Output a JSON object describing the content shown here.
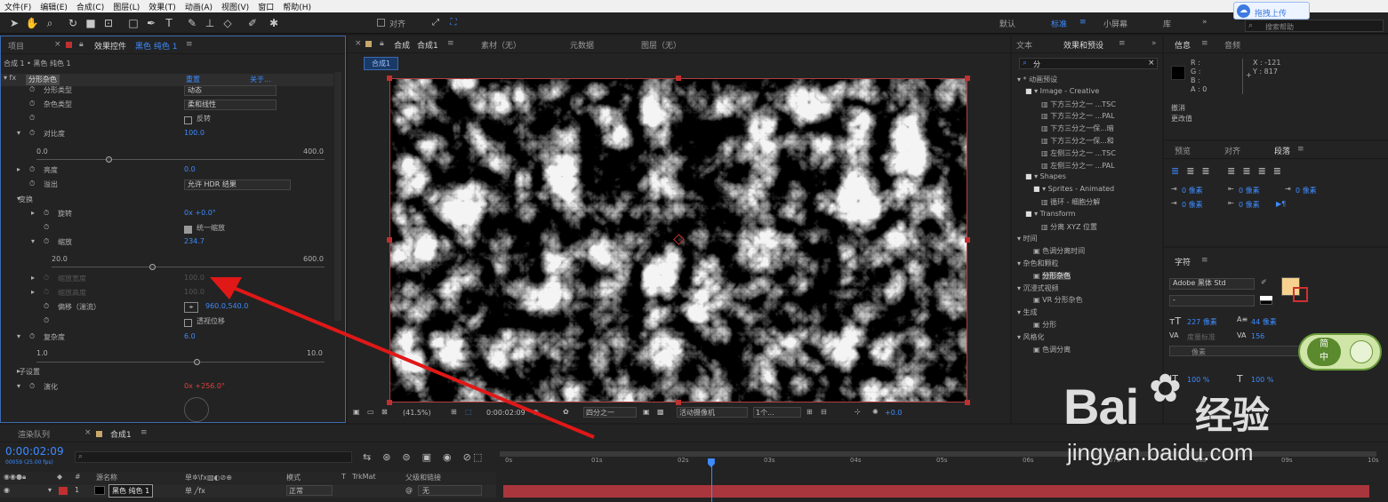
{
  "menu": [
    "文件(F)",
    "编辑(E)",
    "合成(C)",
    "图层(L)",
    "效果(T)",
    "动画(A)",
    "视图(V)",
    "窗口",
    "帮助(H)"
  ],
  "toolbar": {
    "align_label": "对齐",
    "workspaces": [
      "默认",
      "标准",
      "小屏幕",
      "库"
    ],
    "upload_label": "拖拽上传",
    "search_placeholder": "搜索帮助"
  },
  "left_panel": {
    "tab_project": "项目",
    "tab_effects": "效果控件",
    "tab_layer": "黑色 纯色 1",
    "breadcrumb": "合成 1 • 黑色 纯色 1",
    "fx_name": "分形杂色",
    "reset": "重置",
    "about": "关于...",
    "rows": [
      {
        "label": "分形类型",
        "value": "动态",
        "type": "dropdown"
      },
      {
        "label": "杂色类型",
        "value": "柔和线性",
        "type": "dropdown"
      },
      {
        "label": "",
        "value": "反转",
        "type": "checkbox"
      },
      {
        "label": "对比度",
        "value": "100.0",
        "type": "num"
      },
      {
        "label": "亮度",
        "value": "0.0",
        "type": "num"
      },
      {
        "label": "溢出",
        "value": "允许 HDR 结果",
        "type": "dropdown"
      },
      {
        "label": "变换",
        "value": "",
        "type": "group"
      },
      {
        "label": "旋转",
        "value": "0x +0.0°",
        "type": "num"
      },
      {
        "label": "",
        "value": "统一缩放",
        "type": "checkbox"
      },
      {
        "label": "缩放",
        "value": "234.7",
        "type": "num"
      },
      {
        "label": "缩放宽度",
        "value": "100.0",
        "type": "dim"
      },
      {
        "label": "缩放高度",
        "value": "100.0",
        "type": "dim"
      },
      {
        "label": "偏移（湍流）",
        "value": "960.0,540.0",
        "type": "num"
      },
      {
        "label": "",
        "value": "透视位移",
        "type": "checkbox"
      },
      {
        "label": "复杂度",
        "value": "6.0",
        "type": "num"
      },
      {
        "label": "子设置",
        "value": "",
        "type": "group"
      },
      {
        "label": "演化",
        "value": "0x +256.0°",
        "type": "red"
      }
    ],
    "contrast_min": "0.0",
    "contrast_max": "400.0",
    "contrast_value": 25,
    "scale_min": "20.0",
    "scale_max": "600.0",
    "scale_value": 36.9,
    "complexity_min": "1.0",
    "complexity_max": "10.0",
    "complexity_value": 55.6
  },
  "viewer": {
    "tab_comp": "合成",
    "tab_comp_name": "合成1",
    "tab_footage": "素材（无）",
    "tab_meta": "元数据",
    "tab_layer": "图层（无）",
    "chip": "合成1",
    "zoom": "(41.5%)",
    "time": "0:00:02:09",
    "resolution": "四分之一",
    "camera": "活动摄像机",
    "views": "1个...",
    "exposure": "+0.0"
  },
  "effects_panel": {
    "tab_text": "文本",
    "tab_effects": "效果和预设",
    "search_value": "分",
    "tree": [
      {
        "indent": 0,
        "text": "▾ * 动画预设",
        "icon": ""
      },
      {
        "indent": 1,
        "text": "▾ Image - Creative",
        "icon": "folder"
      },
      {
        "indent": 3,
        "text": "下方三分之一 ...TSC",
        "icon": "file"
      },
      {
        "indent": 3,
        "text": "下方三分之一 ...PAL",
        "icon": "file"
      },
      {
        "indent": 3,
        "text": "下方三分之一保...暗",
        "icon": "file"
      },
      {
        "indent": 3,
        "text": "下方三分之一保...和",
        "icon": "file"
      },
      {
        "indent": 3,
        "text": "左侧三分之一 ...TSC",
        "icon": "file"
      },
      {
        "indent": 3,
        "text": "左侧三分之一 ...PAL",
        "icon": "file"
      },
      {
        "indent": 1,
        "text": "▾ Shapes",
        "icon": "folder"
      },
      {
        "indent": 2,
        "text": "▾ Sprites - Animated",
        "icon": "folder"
      },
      {
        "indent": 3,
        "text": "循环 - 细胞分解",
        "icon": "file"
      },
      {
        "indent": 1,
        "text": "▾ Transform",
        "icon": "folder"
      },
      {
        "indent": 3,
        "text": "分离 XYZ 位置",
        "icon": "file"
      },
      {
        "indent": 0,
        "text": "▾ 时间",
        "icon": ""
      },
      {
        "indent": 2,
        "text": "色调分离时间",
        "icon": "fx"
      },
      {
        "indent": 0,
        "text": "▾ 杂色和颗粒",
        "icon": ""
      },
      {
        "indent": 2,
        "text": "分形杂色",
        "icon": "fx",
        "selected": true
      },
      {
        "indent": 0,
        "text": "▾ 沉浸式视频",
        "icon": ""
      },
      {
        "indent": 2,
        "text": "VR 分形杂色",
        "icon": "fx"
      },
      {
        "indent": 0,
        "text": "▾ 生成",
        "icon": ""
      },
      {
        "indent": 2,
        "text": "分形",
        "icon": "fx"
      },
      {
        "indent": 0,
        "text": "▾ 风格化",
        "icon": ""
      },
      {
        "indent": 2,
        "text": "色调分离",
        "icon": "fx"
      }
    ]
  },
  "info_panel": {
    "tab_info": "信息",
    "tab_audio": "音频",
    "r": "R :",
    "g": "G :",
    "b": "B :",
    "a": "A : 0",
    "x": "X : -121",
    "y": "Y : 817",
    "undo1": "撤消",
    "undo2": "更改值"
  },
  "paragraph_panel": {
    "tab_preview": "预览",
    "tab_align": "对齐",
    "tab_para": "段落",
    "px1": "0 像素",
    "px2": "0 像素",
    "px3": "0 像素",
    "px4": "0 像素",
    "px5": "0 像素"
  },
  "char_panel": {
    "tab": "字符",
    "font": "Adobe 黑体 Std",
    "style": "-",
    "size": "227 像素",
    "leading": "44 像素",
    "kerning": "度量标准",
    "tracking": "156",
    "vscale": "100 %",
    "hscale": "100 %",
    "line_px": "像素",
    "fill_color": "#f7d28e"
  },
  "timeline": {
    "tab_render": "渲染队列",
    "tab_comp": "合成1",
    "time": "0:00:02:09",
    "frames": "00059 (25.00 fps)",
    "col_source": "源名称",
    "col_mode": "模式",
    "col_trkmat": "TrkMat",
    "col_parent": "父级和链接",
    "layer_num": "1",
    "layer_name": "黑色 纯色 1",
    "layer_mode": "正常",
    "layer_parent": "无",
    "ruler": [
      "0s",
      "01s",
      "02s",
      "03s",
      "04s",
      "05s",
      "06s",
      "07s",
      "08s",
      "09s",
      "10s"
    ],
    "playhead": 0.239,
    "layer_color": "#a9363d"
  },
  "watermark": {
    "brand": "Bai",
    "brand2": "经验",
    "url": "jingyan.baidu.com",
    "badge1": "简",
    "badge2": "中"
  }
}
